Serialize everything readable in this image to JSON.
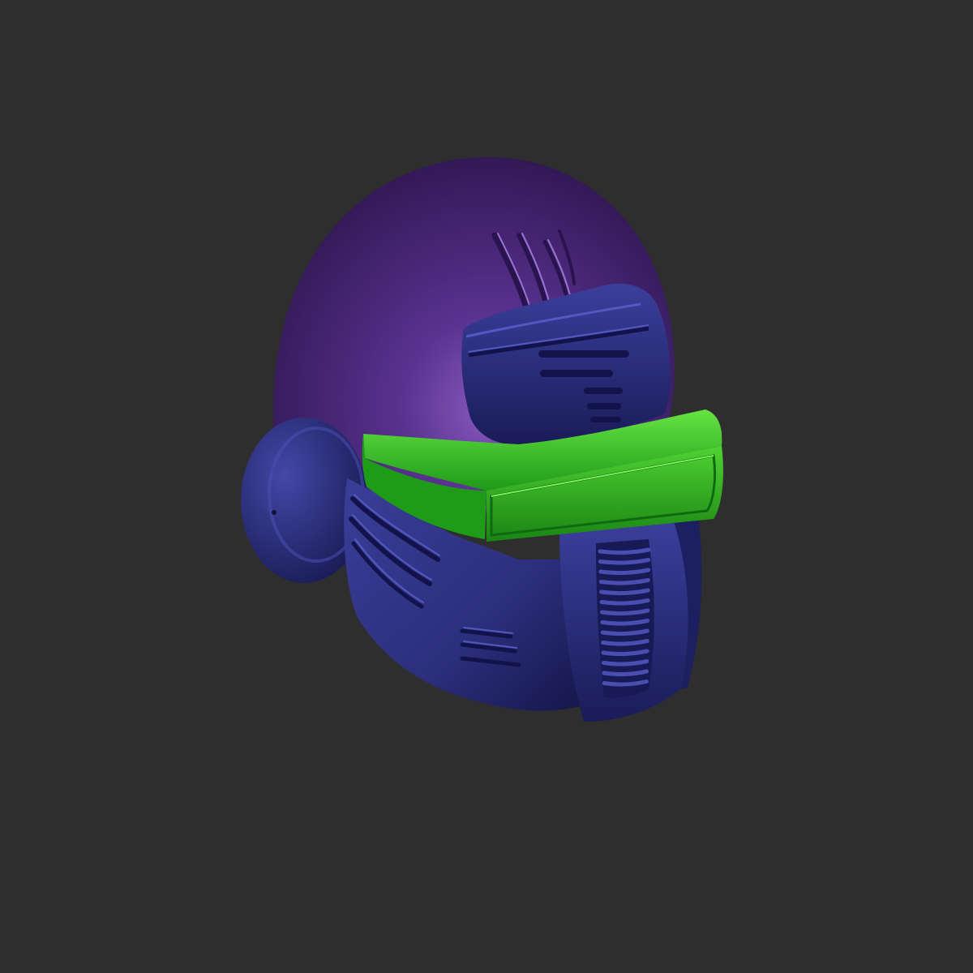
{
  "scene": {
    "subject": "helmet-model-render",
    "colors": {
      "background": "#2e2e2e",
      "dome_purple": "#4a2a78",
      "dome_highlight": "#8a5cc0",
      "armor_navy": "#2c2f7c",
      "armor_navy_dark": "#14164a",
      "visor_green": "#22b41e",
      "visor_green_light": "#58de3c",
      "visor_green_dark": "#0e6a10"
    }
  }
}
